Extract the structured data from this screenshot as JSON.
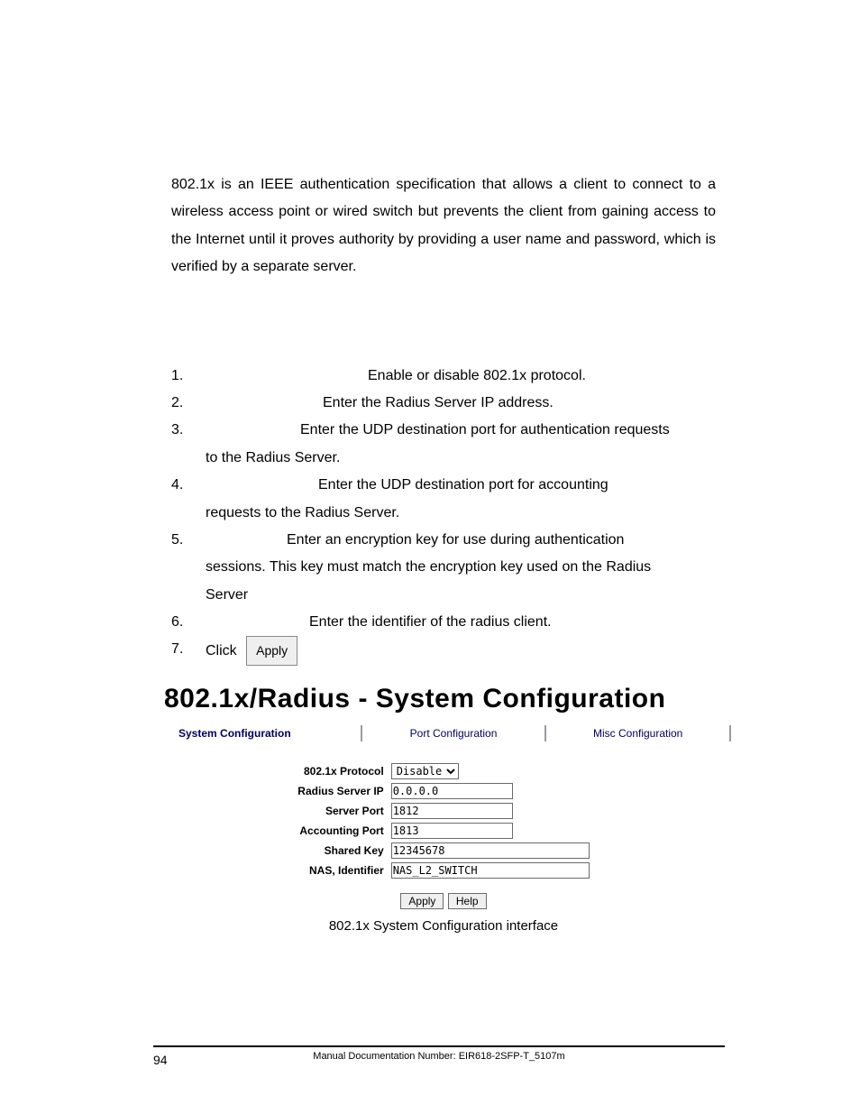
{
  "intro": "802.1x is an IEEE authentication specification that allows a client to connect to a wireless access point or wired switch but prevents the client from gaining access to the Internet until it proves authority by providing a user name and password, which is verified by a separate server.",
  "list": {
    "n1": "1.",
    "t1": "Enable or disable 802.1x protocol.",
    "n2": "2.",
    "t2": "Enter the Radius Server IP address.",
    "n3": "3.",
    "t3a": "Enter the UDP destination port for authentication requests",
    "t3b": "to the Radius Server.",
    "n4": "4.",
    "t4a": "Enter the UDP destination port for accounting",
    "t4b": "requests to the Radius Server.",
    "n5": "5.",
    "t5a": "Enter an encryption key for use during authentication",
    "t5b": "sessions. This key must match the encryption key used on the Radius",
    "t5c": "Server",
    "n6": "6.",
    "t6": "Enter the identifier of the radius client.",
    "n7": "7.",
    "t7": "Click",
    "apply_btn": "Apply"
  },
  "heading": "802.1x/Radius - System Configuration",
  "tabs": {
    "a": "System Configuration",
    "b": "Port Configuration",
    "c": "Misc Configuration"
  },
  "form": {
    "labels": {
      "protocol": "802.1x Protocol",
      "radius_ip": "Radius Server IP",
      "server_port": "Server Port",
      "acct_port": "Accounting Port",
      "shared_key": "Shared Key",
      "nas_id": "NAS, Identifier"
    },
    "values": {
      "protocol": "Disable",
      "radius_ip": "0.0.0.0",
      "server_port": "1812",
      "acct_port": "1813",
      "shared_key": "12345678",
      "nas_id": "NAS_L2_SWITCH"
    },
    "buttons": {
      "apply": "Apply",
      "help": "Help"
    }
  },
  "caption": "802.1x System Configuration interface",
  "footer": {
    "page": "94",
    "doc": "Manual Documentation Number: EIR618-2SFP-T_5107m"
  }
}
